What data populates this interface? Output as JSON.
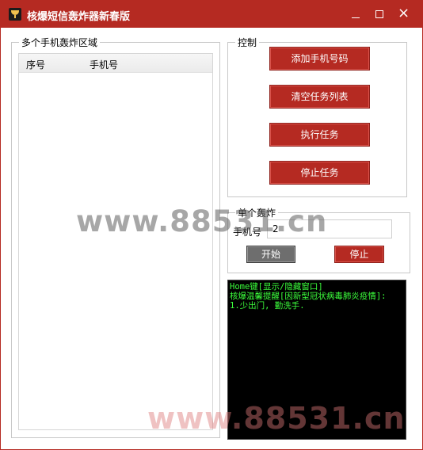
{
  "window": {
    "title": "核爆短信轰炸器新春版",
    "title_color": "#b52a22",
    "controls": [
      "minimize",
      "maximize",
      "close"
    ],
    "close_glyph": "×"
  },
  "left_group": {
    "legend": "多个手机轰炸区域",
    "columns": [
      "序号",
      "手机号"
    ],
    "rows": []
  },
  "control_group": {
    "legend": "控制",
    "buttons": [
      "添加手机号码",
      "清空任务列表",
      "执行任务",
      "停止任务"
    ]
  },
  "single_group": {
    "legend": "单个轰炸",
    "phone_label": "手机号",
    "phone_value": "2",
    "start_label": "开始",
    "stop_label": "停止"
  },
  "console": {
    "lines": [
      "Home键[显示/隐藏窗口]",
      "核爆温馨提醒[因新型冠状病毒肺炎疫情]:",
      "1.少出门, 勤洗手."
    ],
    "text_color": "#3cff3c",
    "background": "#000000"
  },
  "watermarks": [
    "www.88531.cn",
    "www.88531.cn"
  ]
}
